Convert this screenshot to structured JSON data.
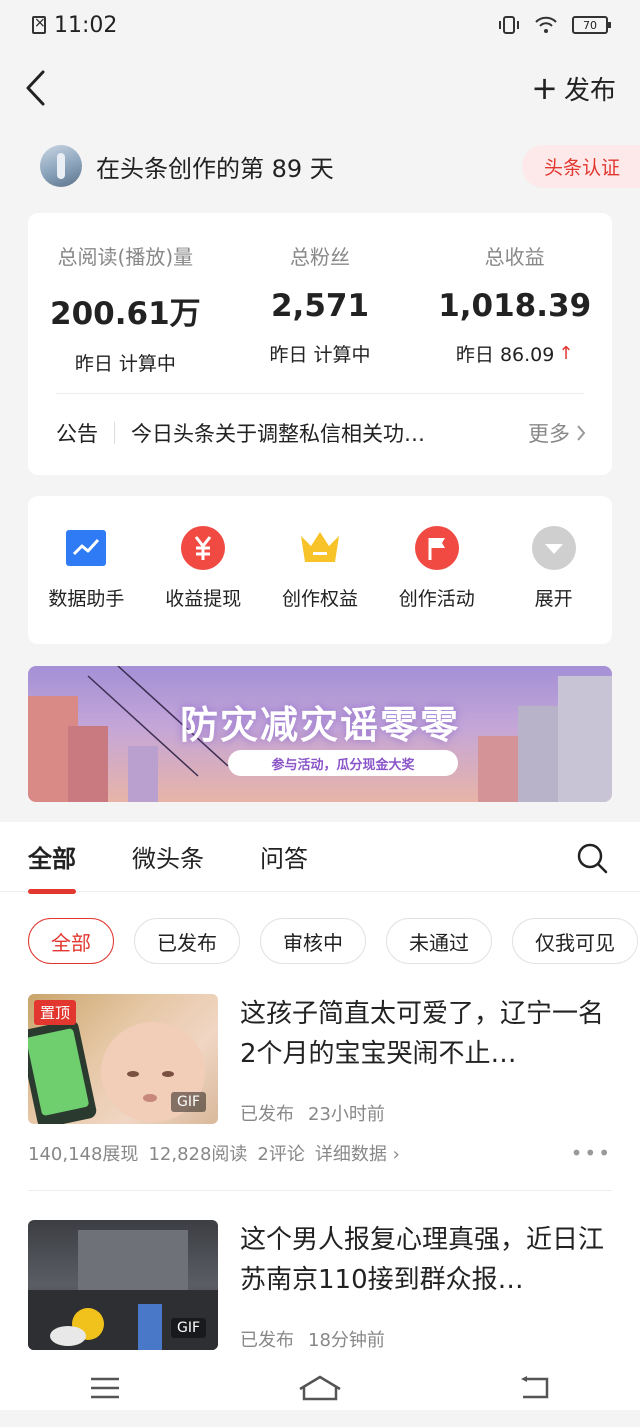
{
  "status_bar": {
    "time": "11:02",
    "battery": "70"
  },
  "nav": {
    "publish_label": "发布"
  },
  "creator": {
    "text": "在头条创作的第 89 天",
    "badge": "头条认证"
  },
  "stats": [
    {
      "label": "总阅读(播放)量",
      "value": "200.61万",
      "sub": "昨日 计算中",
      "trend": ""
    },
    {
      "label": "总粉丝",
      "value": "2,571",
      "sub": "昨日 计算中",
      "trend": ""
    },
    {
      "label": "总收益",
      "value": "1,018.39",
      "sub": "昨日 86.09",
      "trend": "up"
    }
  ],
  "notice": {
    "label": "公告",
    "text": "今日头条关于调整私信相关功…",
    "more": "更多"
  },
  "tools": [
    {
      "label": "数据助手",
      "icon": "chart-icon",
      "color": "#2f7bf5"
    },
    {
      "label": "收益提现",
      "icon": "yuan-icon",
      "color": "#f04a42"
    },
    {
      "label": "创作权益",
      "icon": "crown-icon",
      "color": "#f7c328"
    },
    {
      "label": "创作活动",
      "icon": "flag-icon",
      "color": "#f04a42"
    },
    {
      "label": "展开",
      "icon": "expand-icon",
      "color": "#cfcfcf"
    }
  ],
  "banner": {
    "title": "防灾减灾谣零零",
    "subtitle": "参与活动，瓜分现金大奖"
  },
  "tabs": [
    "全部",
    "微头条",
    "问答"
  ],
  "filters": [
    "全部",
    "已发布",
    "审核中",
    "未通过",
    "仅我可见"
  ],
  "articles": [
    {
      "badge": "置顶",
      "gif": "GIF",
      "title": "这孩子简直太可爱了，辽宁一名2个月的宝宝哭闹不止…",
      "status": "已发布",
      "time": "23小时前",
      "impressions": "140,148展现",
      "reads": "12,828阅读",
      "comments": "2评论",
      "detail": "详细数据"
    },
    {
      "badge": "",
      "gif": "GIF",
      "title": "这个男人报复心理真强，近日江苏南京110接到群众报…",
      "status": "已发布",
      "time": "18分钟前"
    }
  ],
  "accent_color": "#e2372f"
}
